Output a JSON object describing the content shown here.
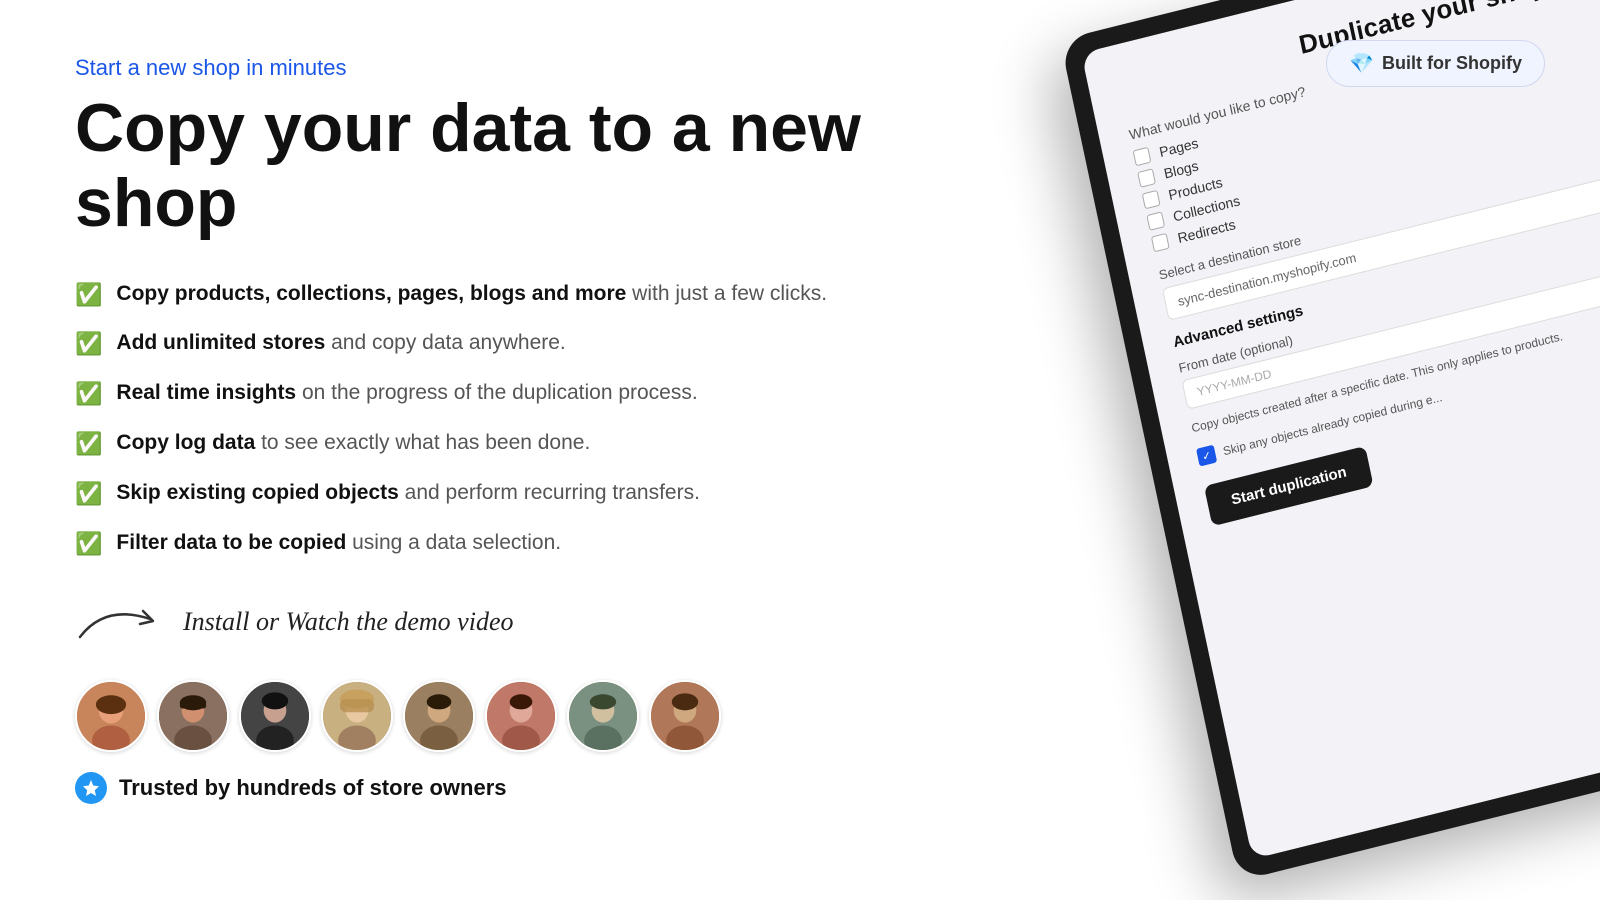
{
  "header": {
    "tagline": "Start a new shop in minutes",
    "title": "Copy your data to a new shop",
    "shopify_badge": "Built for Shopify",
    "shopify_icon": "💎"
  },
  "features": [
    {
      "bold": "Copy products, collections, pages, blogs and more",
      "rest": " with just a few clicks."
    },
    {
      "bold": "Add unlimited stores",
      "rest": " and copy data anywhere."
    },
    {
      "bold": "Real time insights",
      "rest": " on the progress of the duplication process."
    },
    {
      "bold": "Copy log data",
      "rest": " to see exactly what has been done."
    },
    {
      "bold": "Skip existing copied objects",
      "rest": " and perform recurring transfers."
    },
    {
      "bold": "Filter data to be copied",
      "rest": " using a data selection."
    }
  ],
  "demo": {
    "text": "Install or Watch the demo video"
  },
  "trusted": {
    "text": "Trusted by hundreds of store owners"
  },
  "tablet": {
    "title": "Duplicate your shop",
    "copy_label": "What would you like to copy?",
    "checkboxes": [
      "Pages",
      "Blogs",
      "Products",
      "Collections",
      "Redirects"
    ],
    "destination_label": "Select a destination store",
    "destination_value": "sync-destination.myshopify.com",
    "advanced_label": "Advanced settings",
    "from_date_label": "From date (optional)",
    "date_placeholder": "YYYY-MM-DD",
    "copy_objects_text": "Copy objects created after a specific date. This only applies to products.",
    "skip_label": "Skip any objects already copied during e...",
    "start_button": "Start duplication"
  },
  "avatars": [
    {
      "color": "#c8845a",
      "label": "A1"
    },
    {
      "color": "#6b4c2a",
      "label": "A2"
    },
    {
      "color": "#4a3728",
      "label": "A3"
    },
    {
      "color": "#c8a87a",
      "label": "A4"
    },
    {
      "color": "#8a6a3a",
      "label": "A5"
    },
    {
      "color": "#c85a3a",
      "label": "A6"
    },
    {
      "color": "#7a8a6a",
      "label": "A7"
    },
    {
      "color": "#b06040",
      "label": "A8"
    }
  ]
}
